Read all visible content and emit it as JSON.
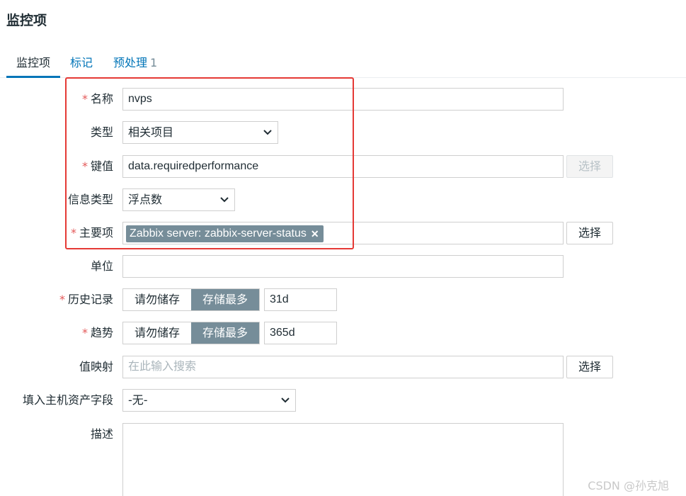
{
  "page": {
    "title": "监控项"
  },
  "tabs": [
    {
      "label": "监控项"
    },
    {
      "label": "标记"
    },
    {
      "label": "预处理",
      "count": "1"
    }
  ],
  "form": {
    "name": {
      "label": "名称",
      "required": "*",
      "value": "nvps"
    },
    "type": {
      "label": "类型",
      "value": "相关项目"
    },
    "key": {
      "label": "键值",
      "required": "*",
      "value": "data.requiredperformance",
      "button": "选择"
    },
    "info_type": {
      "label": "信息类型",
      "value": "浮点数"
    },
    "master_item": {
      "label": "主要项",
      "required": "*",
      "tag": "Zabbix server: zabbix-server-status",
      "tag_remove": "✕",
      "button": "选择"
    },
    "units": {
      "label": "单位",
      "value": ""
    },
    "history": {
      "label": "历史记录",
      "required": "*",
      "opt_off": "请勿储存",
      "opt_on": "存储最多",
      "value": "31d"
    },
    "trends": {
      "label": "趋势",
      "required": "*",
      "opt_off": "请勿储存",
      "opt_on": "存储最多",
      "value": "365d"
    },
    "value_map": {
      "label": "值映射",
      "placeholder": "在此输入搜索",
      "button": "选择"
    },
    "inventory": {
      "label": "填入主机资产字段",
      "value": "-无-"
    },
    "description": {
      "label": "描述",
      "value": ""
    }
  },
  "watermark": "CSDN @孙克旭",
  "colors": {
    "accent": "#0275b8",
    "tag_bg": "#768d99",
    "highlight": "#e53935",
    "required": "#e45959"
  }
}
